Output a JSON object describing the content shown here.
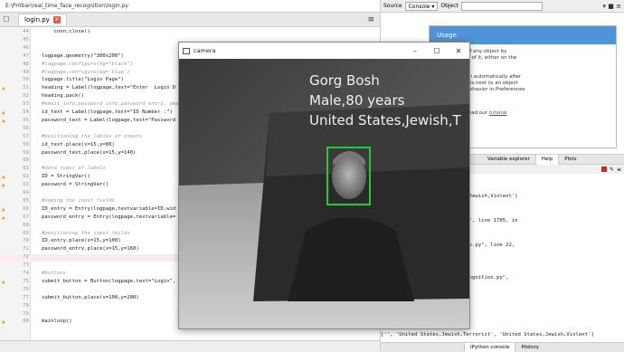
{
  "path_bar": "E:\\Pr0bar\\real_time_face_recognition\\login.py",
  "editor": {
    "tab_label": "login.py",
    "lines": [
      {
        "n": "44",
        "t": "    conn.close()",
        "w": false,
        "c": false
      },
      {
        "n": "45",
        "t": "",
        "w": false,
        "c": false
      },
      {
        "n": "46",
        "t": "",
        "w": false,
        "c": false
      },
      {
        "n": "47",
        "t": "logpage.geometry(\"300x200\")",
        "w": false,
        "c": false
      },
      {
        "n": "48",
        "t": "#logpage.configure(bg=\"black\")",
        "w": false,
        "c": true
      },
      {
        "n": "49",
        "t": "#logpage.configure(bg='blue')",
        "w": false,
        "c": true
      },
      {
        "n": "50",
        "t": "logpage.title(\"Login Page\")",
        "w": false,
        "c": false
      },
      {
        "n": "51",
        "t": "heading = Label(logpage,text=\"Enter  Login D",
        "w": true,
        "c": false
      },
      {
        "n": "52",
        "t": "heading.pack()",
        "w": false,
        "c": false
      },
      {
        "n": "53",
        "t": "#email_info,password_info,password_entry, ema",
        "w": false,
        "c": true
      },
      {
        "n": "54",
        "t": "id_text = Label(logpage,text=\"ID Number :\")",
        "w": true,
        "c": false
      },
      {
        "n": "55",
        "t": "password_text = Label(logpage,text=\"Password",
        "w": true,
        "c": false
      },
      {
        "n": "56",
        "t": "",
        "w": false,
        "c": false
      },
      {
        "n": "57",
        "t": "#positioning the lables of inputs",
        "w": false,
        "c": true
      },
      {
        "n": "58",
        "t": "id_text.place(x=15,y=80)",
        "w": false,
        "c": false
      },
      {
        "n": "59",
        "t": "password_text.place(x=15,y=140)",
        "w": false,
        "c": false
      },
      {
        "n": "60",
        "t": "",
        "w": false,
        "c": false
      },
      {
        "n": "61",
        "t": "#data types of labels",
        "w": false,
        "c": true
      },
      {
        "n": "62",
        "t": "ID = StringVar()",
        "w": true,
        "c": false
      },
      {
        "n": "63",
        "t": "password = StringVar()",
        "w": true,
        "c": false
      },
      {
        "n": "64",
        "t": "",
        "w": false,
        "c": false
      },
      {
        "n": "65",
        "t": "#naming the input fields",
        "w": false,
        "c": true
      },
      {
        "n": "66",
        "t": "ID_entry = Entry(logpage,textvariable=ID,wid",
        "w": true,
        "c": false
      },
      {
        "n": "67",
        "t": "password_entry = Entry(logpage,textvariable=",
        "w": true,
        "c": false
      },
      {
        "n": "68",
        "t": "",
        "w": false,
        "c": false
      },
      {
        "n": "69",
        "t": "#positioning the input feilds",
        "w": false,
        "c": true
      },
      {
        "n": "70",
        "t": "ID_entry.place(x=15,y=100)",
        "w": false,
        "c": false
      },
      {
        "n": "71",
        "t": "password_entry.place(x=15,y=160)",
        "w": false,
        "c": false
      },
      {
        "n": "72",
        "t": "",
        "w": false,
        "c": false,
        "hl": true
      },
      {
        "n": "73",
        "t": "",
        "w": false,
        "c": false
      },
      {
        "n": "74",
        "t": "#buttons",
        "w": false,
        "c": true
      },
      {
        "n": "75",
        "t": "submit_button = Button(logpage,text=\"Login\",",
        "w": true,
        "c": false
      },
      {
        "n": "76",
        "t": "",
        "w": false,
        "c": false
      },
      {
        "n": "77",
        "t": "submit_button.place(x=100,y=200)",
        "w": false,
        "c": false
      },
      {
        "n": "78",
        "t": "",
        "w": false,
        "c": false
      },
      {
        "n": "79",
        "t": "",
        "w": false,
        "c": false
      },
      {
        "n": "80",
        "t": "mainloop()",
        "w": true,
        "c": false
      }
    ]
  },
  "right_pane": {
    "source_label": "Source",
    "console_select": "Console",
    "object_label": "Object",
    "usage_title": "Usage",
    "usage_lines": [
      "an get help of any object by",
      "ctrl+I in front of it, either on the",
      "he Console.",
      "",
      "also be shown automatically after",
      "eft parenthesis next to an object",
      "ctivate this behavior in Preferences",
      "",
      ""
    ],
    "usage_link_prefix": "to Spyder? Read our ",
    "usage_link": "tutorial",
    "pane_tabs": [
      "Variable explorer",
      "Help",
      "Plots"
    ],
    "console_lines": [
      "ump']",
      ",60 years']",
      "i,Terrorist', 'United States,Jewish,Violent']",
      "ack",
      "  last):",
      "onda3\\lib\\tkinter\\__init__.py\", line 1705, in",
      "",
      "",
      "ime_face_recognition\\AdminPage.py\", line 22,",
      "",
      "",
      "",
      "ime_face_recognition\\face_recognition.py\",",
      "",
      "",
      "ot defined",
      "",
      "rump']",
      ",60 years']",
      "['', 'United States,Jewish,Terrorist', 'United States,Jewish,Violent']"
    ],
    "console_tabs": [
      "IPython console",
      "History"
    ]
  },
  "camera": {
    "title": "camera",
    "overlay_lines": [
      "Gorg Bosh",
      "Male,80 years",
      "United States,Jewish,T"
    ],
    "box_color": "#22cc33"
  }
}
